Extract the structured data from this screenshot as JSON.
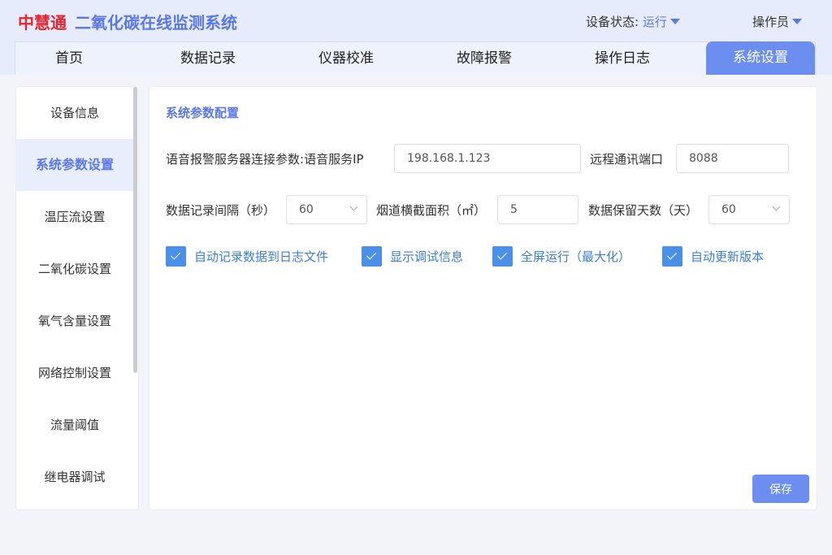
{
  "header": {
    "logo": "中慧通",
    "system_title": "二氧化碳在线监测系统",
    "status_label": "设备状态:",
    "status_value": "运行",
    "operator": "操作员"
  },
  "tabs": [
    {
      "label": "首页",
      "active": false
    },
    {
      "label": "数据记录",
      "active": false
    },
    {
      "label": "仪器校准",
      "active": false
    },
    {
      "label": "故障报警",
      "active": false
    },
    {
      "label": "操作日志",
      "active": false
    },
    {
      "label": "系统设置",
      "active": true
    }
  ],
  "sidebar": {
    "items": [
      {
        "label": "设备信息"
      },
      {
        "label": "系统参数设置",
        "active": true
      },
      {
        "label": "温压流设置"
      },
      {
        "label": "二氧化碳设置"
      },
      {
        "label": "氧气含量设置"
      },
      {
        "label": "网络控制设置"
      },
      {
        "label": "流量阈值"
      },
      {
        "label": "继电器调试"
      }
    ]
  },
  "panel": {
    "title": "系统参数配置",
    "voice_label": "语音报警服务器连接参数:",
    "voice_ip_label": "语音服务IP",
    "voice_ip_value": "198.168.1.123",
    "remote_port_label": "远程通讯端口",
    "remote_port_value": "8088",
    "interval_label": "数据记录间隔（秒）",
    "interval_value": "60",
    "flue_area_label": "烟道横截面积（㎡）",
    "flue_area_value": "5",
    "retention_label": "数据保留天数（天）",
    "retention_value": "60",
    "checkboxes": [
      {
        "label": "自动记录数据到日志文件",
        "checked": true
      },
      {
        "label": "显示调试信息",
        "checked": true
      },
      {
        "label": "全屏运行（最大化）",
        "checked": true
      },
      {
        "label": "自动更新版本",
        "checked": true
      }
    ],
    "save_label": "保存"
  },
  "colors": {
    "accent": "#6b8ef0",
    "brand_red": "#e8232b",
    "checkbox": "#4a90e8"
  }
}
